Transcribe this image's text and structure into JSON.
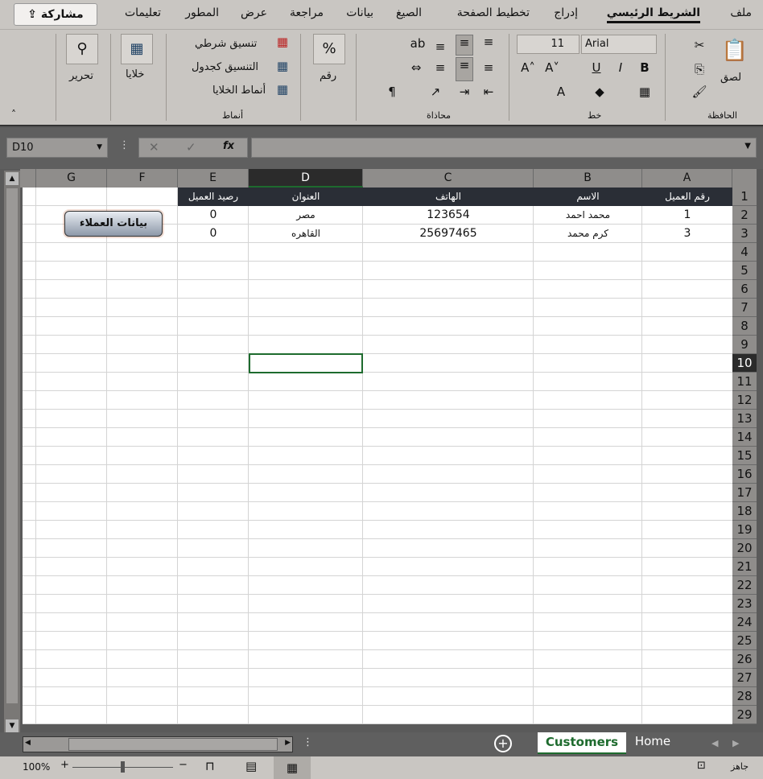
{
  "tabs": [
    "ملف",
    "الشريط الرئيسي",
    "إدراج",
    "تخطيط الصفحة",
    "الصيغ",
    "بيانات",
    "مراجعة",
    "عرض",
    "المطور",
    "تعليمات"
  ],
  "share": "مشاركة",
  "ribbon": {
    "paste": "لصق",
    "clipboard": "الحافظة",
    "font_name": "Arial",
    "font_size": "11",
    "font_group": "خط",
    "alignment_group": "محاذاة",
    "number_label": "رقم",
    "conditional": "تنسيق شرطي",
    "table_format": "التنسيق كجدول",
    "cell_styles": "أنماط الخلايا",
    "styles_group": "أنماط",
    "cells": "خلايا",
    "editing": "تحرير"
  },
  "namebox": "D10",
  "columns": [
    "A",
    "B",
    "C",
    "D",
    "E",
    "F",
    "G"
  ],
  "rows": 29,
  "cells": {
    "header": [
      "رقم العميل",
      "الاسم",
      "الهاتف",
      "العنوان",
      "رصيد العميل"
    ],
    "data": [
      [
        "1",
        "محمد احمد",
        "123654",
        "مصر",
        "0"
      ],
      [
        "3",
        "كرم محمد",
        "25697465",
        "القاهره",
        "0"
      ]
    ]
  },
  "shape_button": "بيانات العملاء",
  "sheets": [
    "Customers",
    "Home"
  ],
  "status": {
    "ready": "جاهز",
    "zoom": "100%"
  }
}
